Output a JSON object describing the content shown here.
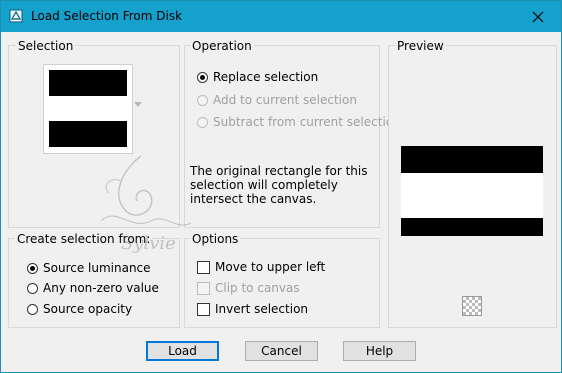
{
  "window": {
    "title": "Load Selection From Disk"
  },
  "selection_group": {
    "legend": "Selection"
  },
  "operation_group": {
    "legend": "Operation",
    "options": [
      {
        "label": "Replace selection",
        "checked": true,
        "enabled": true
      },
      {
        "label": "Add to current selection",
        "checked": false,
        "enabled": false
      },
      {
        "label": "Subtract from current selection",
        "checked": false,
        "enabled": false
      }
    ],
    "info_text": "The original rectangle for this selection will completely intersect the canvas."
  },
  "preview_group": {
    "legend": "Preview"
  },
  "create_group": {
    "legend": "Create selection from:",
    "options": [
      {
        "label": "Source luminance",
        "checked": true
      },
      {
        "label": "Any non-zero value",
        "checked": false
      },
      {
        "label": "Source opacity",
        "checked": false
      }
    ]
  },
  "options_group": {
    "legend": "Options",
    "items": [
      {
        "label": "Move to upper left",
        "checked": false,
        "enabled": true
      },
      {
        "label": "Clip to canvas",
        "checked": false,
        "enabled": false
      },
      {
        "label": "Invert selection",
        "checked": false,
        "enabled": true
      }
    ]
  },
  "buttons": {
    "load": "Load",
    "cancel": "Cancel",
    "help": "Help"
  },
  "watermark": {
    "text": "Sylvie"
  },
  "colors": {
    "titlebar": "#14a1cc",
    "accent": "#0078d7"
  }
}
